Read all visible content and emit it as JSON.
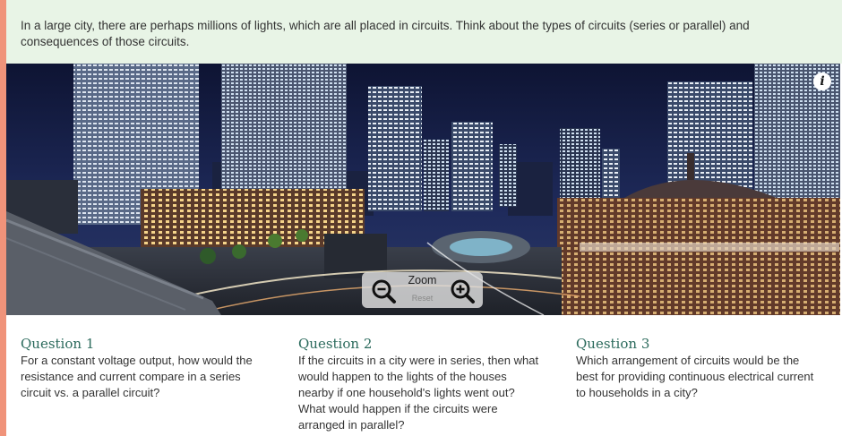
{
  "banner": {
    "text": "In a large city, there are perhaps millions of lights, which are all placed in circuits. Think about the types of circuits (series or parallel) and consequences of those circuits."
  },
  "viewer": {
    "info_icon": "info-icon",
    "zoom": {
      "label": "Zoom",
      "reset_label": "Reset",
      "zoom_out_icon": "zoom-out-icon",
      "zoom_in_icon": "zoom-in-icon"
    }
  },
  "questions": [
    {
      "title": "Question 1",
      "text": "For a constant voltage output, how would the resistance and current compare in a series circuit vs. a parallel circuit?"
    },
    {
      "title": "Question 2",
      "text": "If the circuits in a city were in series, then what would happen to the lights of the houses nearby if one household's lights went out? What would happen if the circuits were arranged in parallel?"
    },
    {
      "title": "Question 3",
      "text": "Which arrangement of circuits would be the best for providing continuous electrical current to households in a city?"
    }
  ],
  "colors": {
    "accent": "#f0937a",
    "banner_bg": "#e8f4e6",
    "question_title": "#2b6a5c"
  }
}
